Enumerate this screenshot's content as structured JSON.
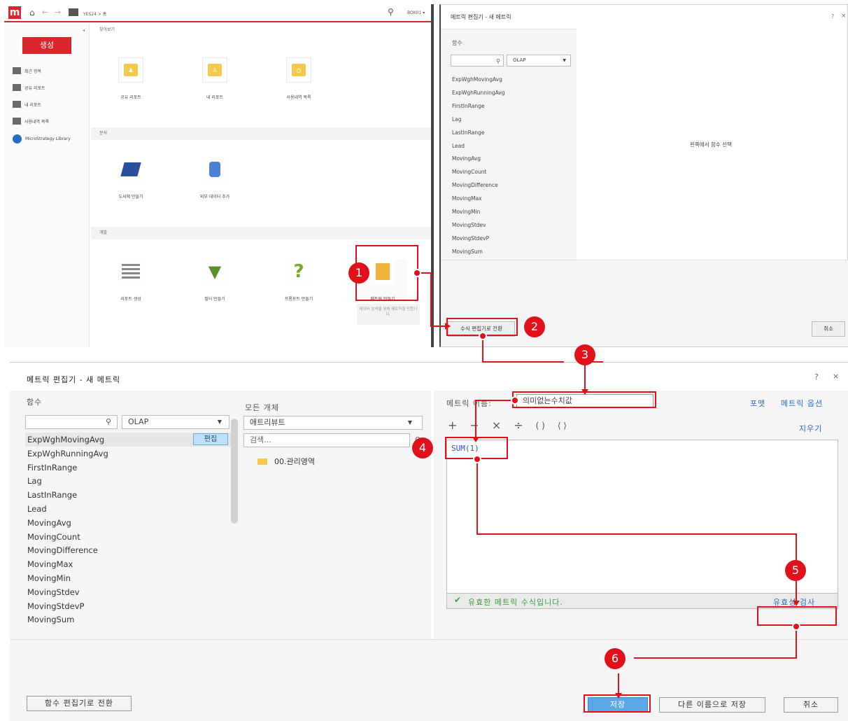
{
  "app": {
    "breadcrumb": "YES24 > 홈",
    "user": "BOK01 ▾",
    "create_label": "생성",
    "nav": [
      {
        "label": "최근 항목",
        "icon": "clock-icon"
      },
      {
        "label": "공유 리포트",
        "icon": "shared-folder-icon"
      },
      {
        "label": "내 리포트",
        "icon": "my-folder-icon"
      },
      {
        "label": "사용내역 목록",
        "icon": "history-icon"
      },
      {
        "label": "MicroStrategy Library",
        "icon": "library-icon"
      }
    ],
    "sections": {
      "browse": "찾아보기",
      "analysis": "분석",
      "dev": "개발"
    },
    "browse_tiles": [
      "공유 리포트",
      "내 리포트",
      "사용내역 목록"
    ],
    "analysis_tiles": [
      "도씨에 만들기",
      "외부 데이터 추가"
    ],
    "dev_tiles": [
      "리포트 생성",
      "필터 만들기",
      "프롬프트 만들기",
      "메트릭 만들기"
    ],
    "metric_tooltip": "데이터 분석을 위해 메트릭을 만듭니다."
  },
  "dialog_small": {
    "title": "메트릭 편집기 - 새 메트릭",
    "functions_label": "함수",
    "dropdown": "OLAP",
    "functions": [
      "ExpWghMovingAvg",
      "ExpWghRunningAvg",
      "FirstInRange",
      "Lag",
      "LastInRange",
      "Lead",
      "MovingAvg",
      "MovingCount",
      "MovingDifference",
      "MovingMax",
      "MovingMin",
      "MovingStdev",
      "MovingStdevP",
      "MovingSum"
    ],
    "hint": "왼쪽에서 함수 선택",
    "switch_btn": "수식 편집기로 전환",
    "cancel_btn": "취소",
    "help": "?",
    "close": "×"
  },
  "dialog_main": {
    "title": "메트릭 편집기 - 새 메트릭",
    "help": "?",
    "close": "×",
    "functions_label": "함수",
    "dropdown": "OLAP",
    "edit_btn": "편집",
    "functions": [
      "ExpWghMovingAvg",
      "ExpWghRunningAvg",
      "FirstInRange",
      "Lag",
      "LastInRange",
      "Lead",
      "MovingAvg",
      "MovingCount",
      "MovingDifference",
      "MovingMax",
      "MovingMin",
      "MovingStdev",
      "MovingStdevP",
      "MovingSum"
    ],
    "all_objects_label": "모든 개체",
    "objects_dropdown": "애트리뷰트",
    "search_placeholder": "검색...",
    "folder": "00.관리영역",
    "metric_name_label": "메트릭 이름:",
    "metric_name_value": "의미없는수치값",
    "format_link": "포맷",
    "options_link": "메트릭 옵션",
    "operators": [
      "+",
      "−",
      "×",
      "÷",
      "( )",
      "⟨ ⟩"
    ],
    "clear_link": "지우기",
    "formula": "SUM(1)",
    "valid_msg": "유효한 메트릭 수식입니다.",
    "validate_link": "유효성 검사",
    "switch_btn": "함수 편집기로 전환",
    "save_btn": "저장",
    "save_as_btn": "다른 이름으로 저장",
    "cancel_btn": "취소"
  },
  "steps": [
    "1",
    "2",
    "3",
    "4",
    "5",
    "6"
  ],
  "colors": {
    "accent": "#e0111b",
    "brand": "#d9262b",
    "link": "#2d6ac1",
    "valid": "#3a9b3a",
    "save": "#5aa9e6"
  }
}
